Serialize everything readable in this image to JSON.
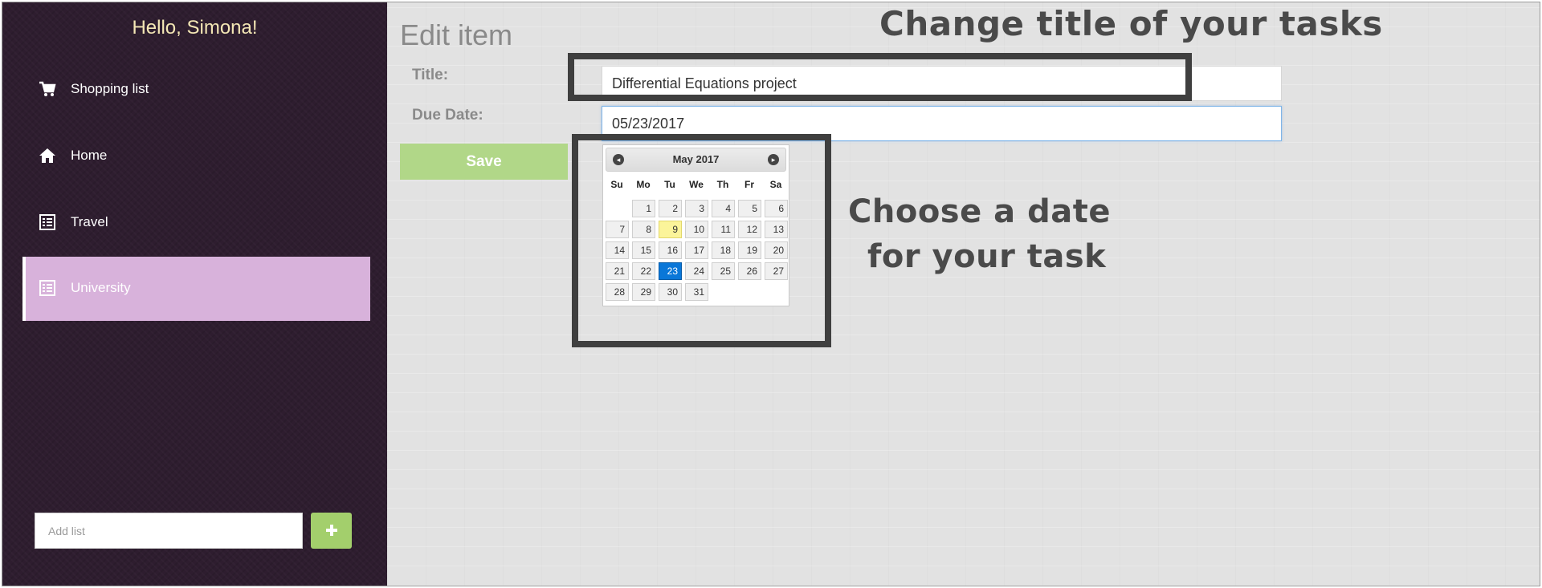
{
  "sidebar": {
    "greeting": "Hello, Simona!",
    "items": [
      {
        "label": "Shopping list",
        "icon": "cart-icon"
      },
      {
        "label": "Home",
        "icon": "home-icon"
      },
      {
        "label": "Travel",
        "icon": "list-icon"
      },
      {
        "label": "University",
        "icon": "list-icon",
        "active": true
      }
    ],
    "add_list_placeholder": "Add list",
    "add_button_label": "+"
  },
  "main": {
    "title": "Edit item",
    "title_label": "Title:",
    "title_value": "Differential Equations project",
    "due_label": "Due Date:",
    "due_value": "05/23/2017",
    "save_label": "Save"
  },
  "datepicker": {
    "month_label": "May 2017",
    "prev_label": "◂",
    "next_label": "▸",
    "weekdays": [
      "Su",
      "Mo",
      "Tu",
      "We",
      "Th",
      "Fr",
      "Sa"
    ],
    "days": [
      "1",
      "2",
      "3",
      "4",
      "5",
      "6",
      "7",
      "8",
      "9",
      "10",
      "11",
      "12",
      "13",
      "14",
      "15",
      "16",
      "17",
      "18",
      "19",
      "20",
      "21",
      "22",
      "23",
      "24",
      "25",
      "26",
      "27",
      "28",
      "29",
      "30",
      "31"
    ],
    "first_weekday_index": 1,
    "today": "9",
    "selected": "23"
  },
  "annotations": {
    "title_hint": "Change title of your tasks",
    "date_hint_line1": "Choose a date",
    "date_hint_line2": "for your task"
  },
  "colors": {
    "sidebar_bg": "#2e1d2f",
    "active_item": "#d8b2db",
    "greeting": "#f4e7b5",
    "accent_green": "#a3cf6c",
    "selected_day": "#0a77d8",
    "today_day": "#fbf49a"
  }
}
